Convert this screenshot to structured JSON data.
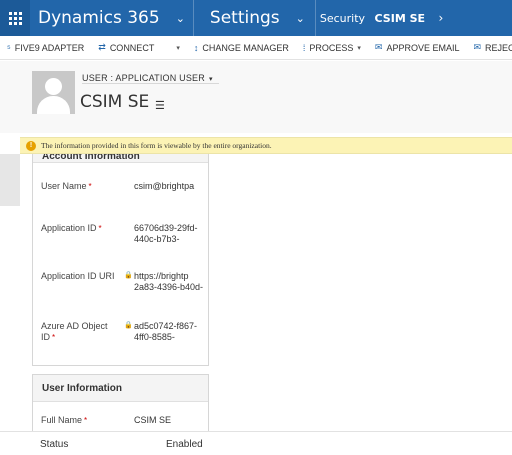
{
  "nav": {
    "app_name": "Dynamics 365",
    "area": "Settings",
    "breadcrumb_1": "Security",
    "breadcrumb_2": "CSIM SE",
    "chevron": "⌄",
    "crumb_arrow": "›"
  },
  "commands": [
    {
      "label": "FIVE9 ADAPTER",
      "icon": "five9-icon",
      "glyph": "⁵",
      "dropdown": false
    },
    {
      "label": "CONNECT",
      "icon": "connect-icon",
      "glyph": "⇄",
      "dropdown": true
    },
    {
      "label": "CHANGE MANAGER",
      "icon": "change-manager-icon",
      "glyph": "↕",
      "dropdown": false
    },
    {
      "label": "PROCESS",
      "icon": "process-icon",
      "glyph": "⁞",
      "dropdown": true
    },
    {
      "label": "APPROVE EMAIL",
      "icon": "approve-email-icon",
      "glyph": "✉",
      "dropdown": false
    },
    {
      "label": "REJECT EM",
      "icon": "reject-email-icon",
      "glyph": "✉",
      "dropdown": false
    }
  ],
  "header": {
    "form_selector": "USER : APPLICATION USER",
    "record_name": "CSIM SE"
  },
  "notification": {
    "text": "The information provided in this form is viewable by the entire organization."
  },
  "account_section": {
    "title": "Account Information",
    "fields": [
      {
        "label": "User Name",
        "required": true,
        "locked": false,
        "value": "csim@brightpa"
      },
      {
        "label": "Application ID",
        "required": true,
        "locked": false,
        "value": "66706d39-29fd-440c-b7b3-"
      },
      {
        "label": "Application ID URI",
        "required": false,
        "locked": true,
        "value": "https://brightp 2a83-4396-b40d-"
      },
      {
        "label": "Azure AD Object ID",
        "required": true,
        "locked": true,
        "value": "ad5c0742-f867-4ff0-8585-"
      }
    ]
  },
  "user_section": {
    "title": "User Information",
    "fields": [
      {
        "label": "Full Name",
        "required": true,
        "value": "CSIM SE"
      }
    ]
  },
  "footer": {
    "status_label": "Status",
    "status_value": "Enabled"
  },
  "colors": {
    "nav_bg": "#2266aa",
    "notice_bg": "#fcf3b5",
    "required": "#cc0000"
  }
}
